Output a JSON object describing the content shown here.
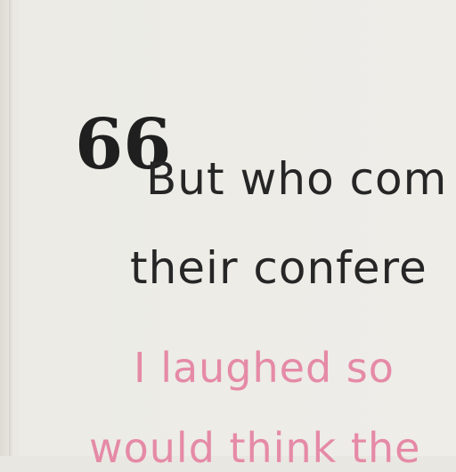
{
  "note": {
    "top_fragment": "~~~",
    "quote_mark": "66",
    "lines_black": [
      "But who com",
      "their confere"
    ],
    "lines_pink": [
      "I laughed  so",
      "would think the"
    ]
  }
}
